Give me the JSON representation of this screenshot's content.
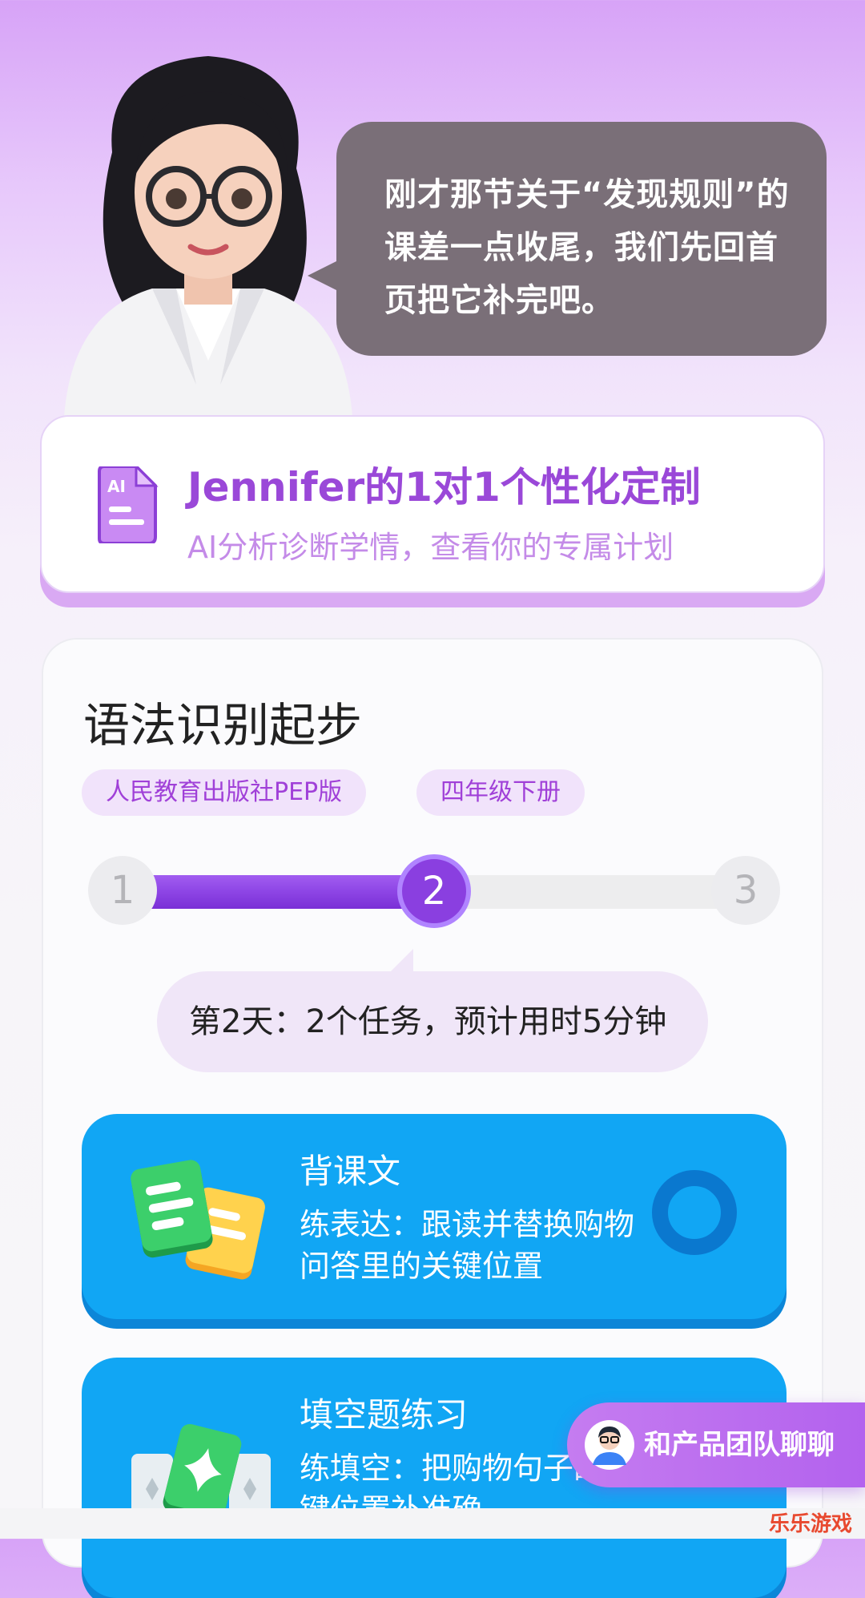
{
  "teacher": {
    "speech": "刚才那节关于“发现规则”的课差一点收尾，我们先回首页把它补完吧。"
  },
  "plan": {
    "icon": "ai-document-icon",
    "icon_text": "AI",
    "title": "Jennifer的1对1个性化定制",
    "subtitle": "AI分析诊断学情，查看你的专属计划"
  },
  "course": {
    "title": "语法识别起步",
    "tags": [
      "人民教育出版社PEP版",
      "四年级下册"
    ],
    "steps": [
      "1",
      "2",
      "3"
    ],
    "current_step": 2,
    "progress_fraction": 0.5,
    "day_info": "第2天：2个任务，预计用时5分钟"
  },
  "tasks": [
    {
      "title": "背课文",
      "desc": "练表达：跟读并替换购物问答里的关键位置",
      "icon": "flashcards-icon"
    },
    {
      "title": "填空题练习",
      "desc": "练填空：把购物句子的关键位置补准确",
      "icon": "puzzle-cards-icon"
    }
  ],
  "chat_button": {
    "label": "和产品团队聊聊",
    "icon": "team-avatar-icon"
  },
  "watermark": "乐乐游戏",
  "colors": {
    "accent": "#8a3fe0",
    "task_blue": "#11a6f4",
    "bubble_gray": "#7a6f78"
  }
}
